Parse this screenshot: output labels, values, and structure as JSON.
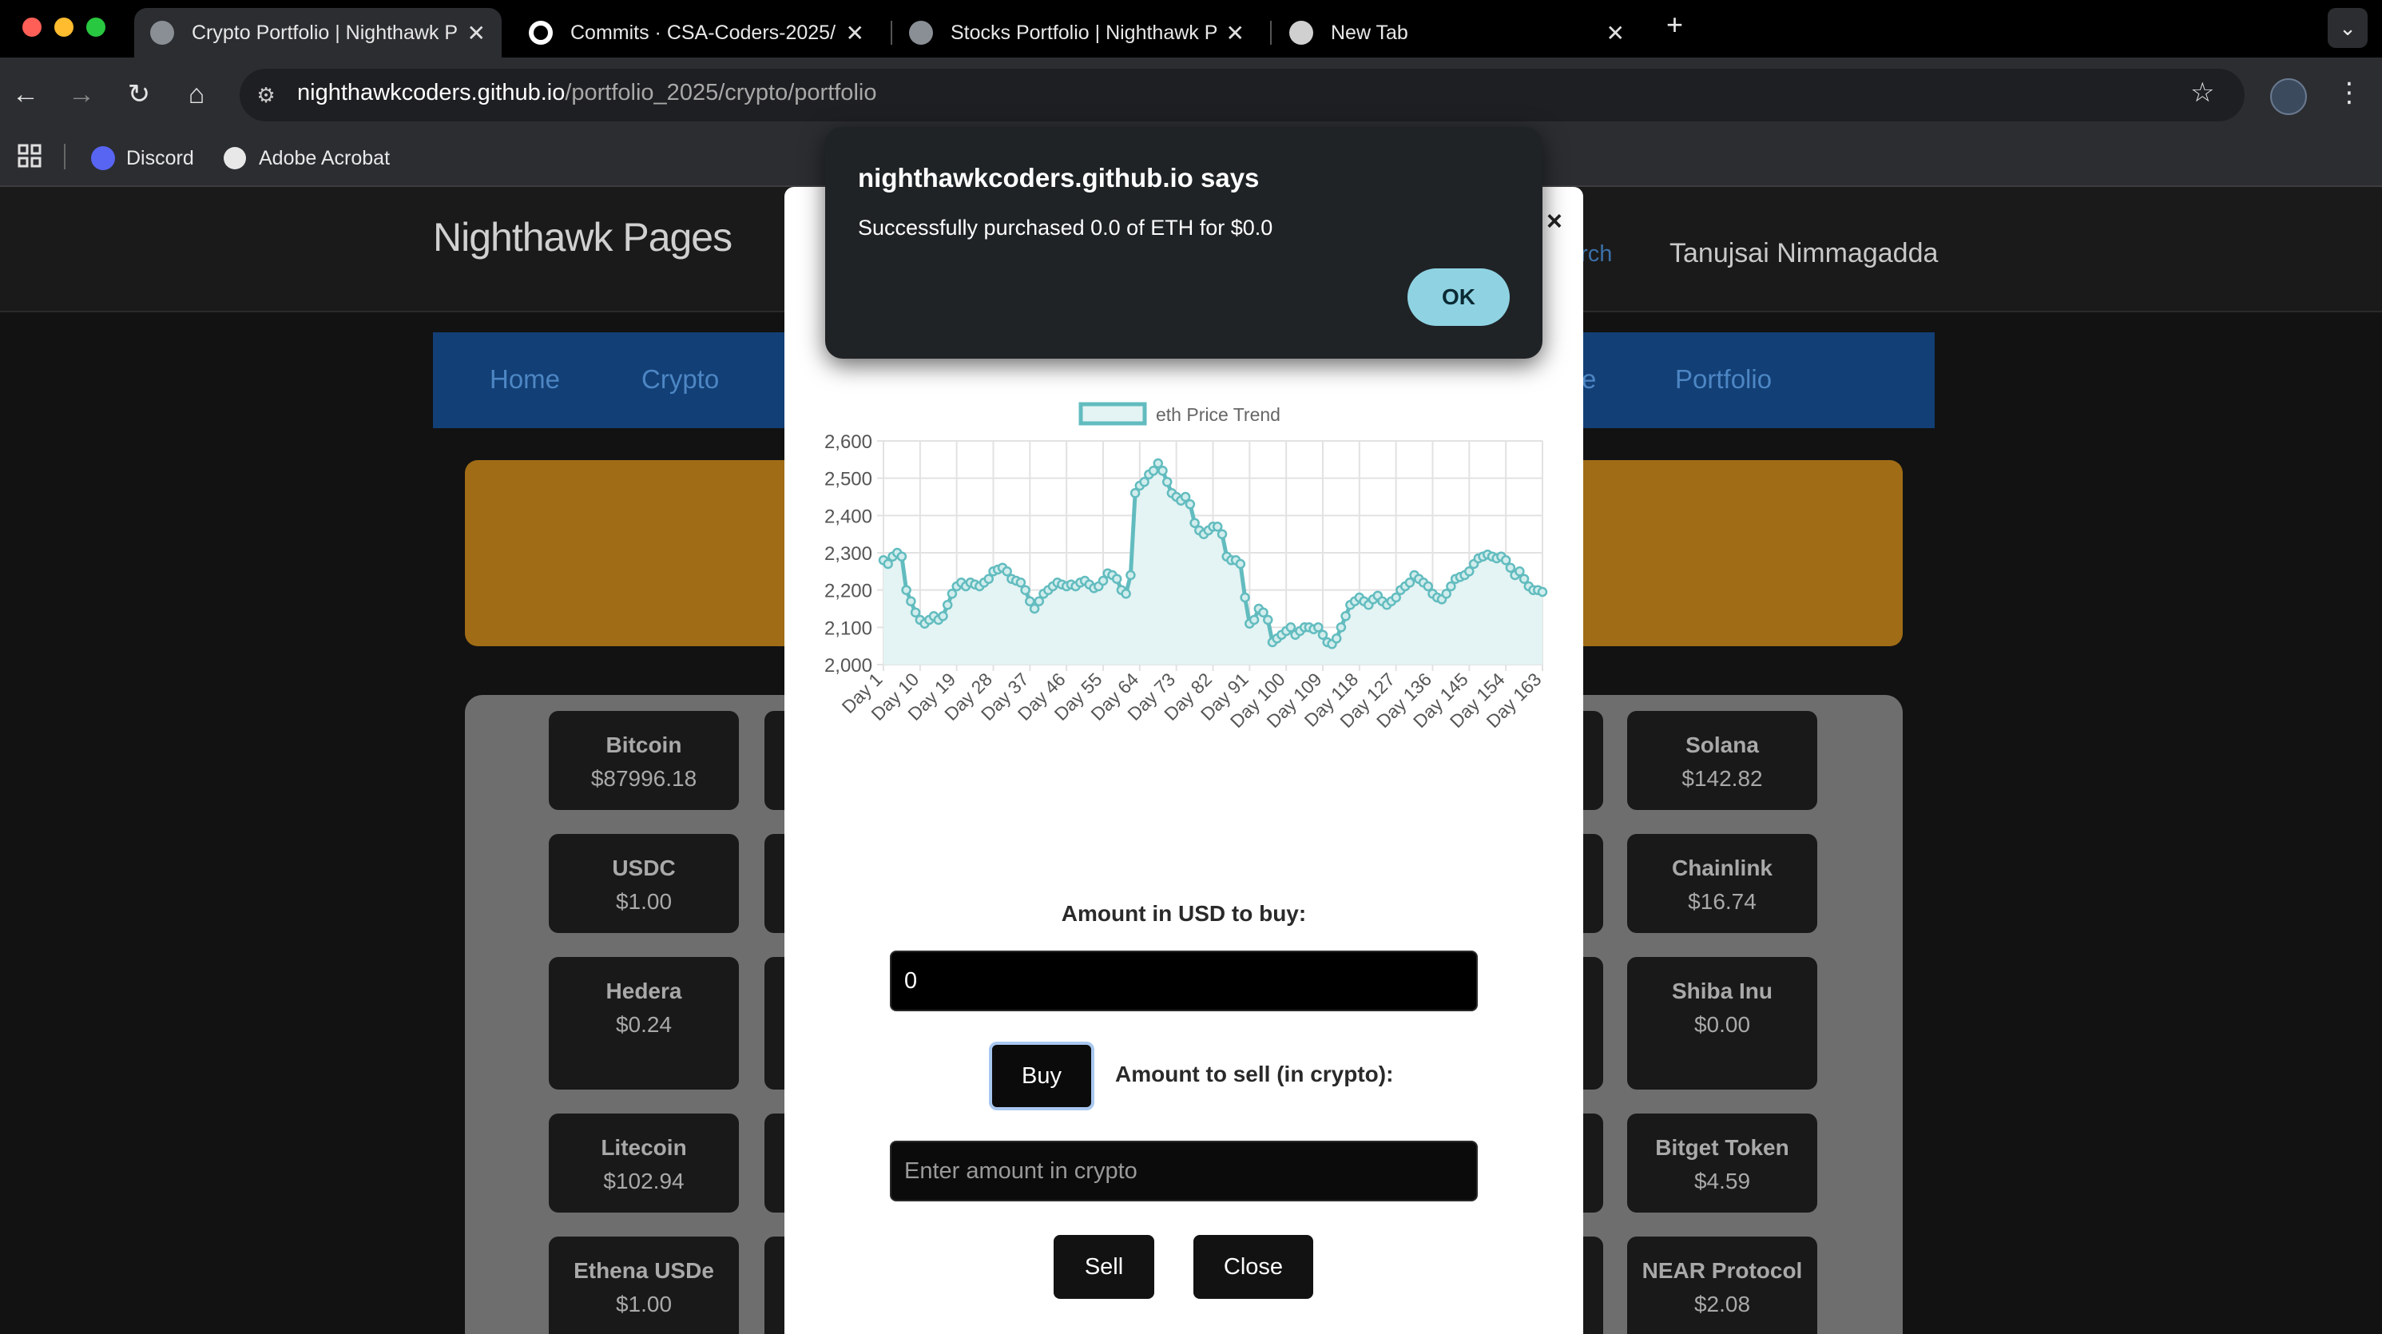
{
  "browser": {
    "tabs": [
      {
        "label": "Crypto Portfolio | Nighthawk P"
      },
      {
        "label": "Commits · CSA-Coders-2025/"
      },
      {
        "label": "Stocks Portfolio | Nighthawk P"
      },
      {
        "label": "New Tab"
      }
    ],
    "url_host": "nighthawkcoders.github.io",
    "url_path": "/portfolio_2025/crypto/portfolio",
    "bookmarks": [
      {
        "label": "Discord"
      },
      {
        "label": "Adobe Acrobat"
      }
    ]
  },
  "header": {
    "brand": "Nighthawk Pages",
    "search_link": "arch",
    "user": "Tanujsai Nimmagadda"
  },
  "nav": {
    "left": [
      {
        "label": "Home"
      },
      {
        "label": "Crypto"
      }
    ],
    "right": [
      {
        "label": "e"
      },
      {
        "label": "Portfolio"
      }
    ]
  },
  "crypto_cards": [
    {
      "name": "Bitcoin",
      "price": "$87996.18"
    },
    {
      "name": "Solana",
      "price": "$142.82"
    },
    {
      "name": "USDC",
      "price": "$1.00"
    },
    {
      "name": "Chainlink",
      "price": "$16.74"
    },
    {
      "name": "Hedera",
      "price": "$0.24"
    },
    {
      "name": "Shiba Inu",
      "price": "$0.00"
    },
    {
      "name": "Litecoin",
      "price": "$102.94"
    },
    {
      "name": "Bitget Token",
      "price": "$4.59"
    },
    {
      "name": "Ethena USDe",
      "price": "$1.00"
    },
    {
      "name": "NEAR Protocol",
      "price": "$2.08"
    }
  ],
  "modal": {
    "close_glyph": "×",
    "buy_label": "Amount in USD to buy:",
    "buy_value": "0",
    "buy_button": "Buy",
    "sell_label": "Amount to sell (in crypto):",
    "sell_placeholder": "Enter amount in crypto",
    "sell_button": "Sell",
    "close_button": "Close"
  },
  "alert": {
    "title": "nighthawkcoders.github.io says",
    "message": "Successfully purchased 0.0 of ETH for $0.0",
    "ok": "OK"
  },
  "colors": {
    "line": "#62bcbf",
    "fill": "#e4f3f3",
    "banner": "#a06c16",
    "navbar": "#123f75"
  },
  "chart_data": {
    "type": "line",
    "legend": "eth Price Trend",
    "ylim": [
      2000,
      2600
    ],
    "yticks": [
      "2,000",
      "2,100",
      "2,200",
      "2,300",
      "2,400",
      "2,500",
      "2,600"
    ],
    "xtick_labels": [
      "Day 1",
      "Day 10",
      "Day 19",
      "Day 28",
      "Day 37",
      "Day 46",
      "Day 55",
      "Day 64",
      "Day 73",
      "Day 82",
      "Day 91",
      "Day 100",
      "Day 109",
      "Day 118",
      "Day 127",
      "Day 136",
      "Day 145",
      "Day 154",
      "Day 163"
    ],
    "points": [
      [
        1,
        2280
      ],
      [
        2,
        2270
      ],
      [
        3,
        2290
      ],
      [
        4,
        2300
      ],
      [
        5,
        2290
      ],
      [
        6,
        2200
      ],
      [
        7,
        2170
      ],
      [
        8,
        2140
      ],
      [
        9,
        2120
      ],
      [
        10,
        2110
      ],
      [
        11,
        2120
      ],
      [
        12,
        2130
      ],
      [
        13,
        2120
      ],
      [
        14,
        2130
      ],
      [
        15,
        2160
      ],
      [
        16,
        2190
      ],
      [
        17,
        2210
      ],
      [
        18,
        2220
      ],
      [
        19,
        2210
      ],
      [
        20,
        2220
      ],
      [
        21,
        2215
      ],
      [
        22,
        2210
      ],
      [
        23,
        2220
      ],
      [
        24,
        2230
      ],
      [
        25,
        2250
      ],
      [
        26,
        2255
      ],
      [
        27,
        2260
      ],
      [
        28,
        2250
      ],
      [
        29,
        2230
      ],
      [
        30,
        2225
      ],
      [
        31,
        2220
      ],
      [
        32,
        2200
      ],
      [
        33,
        2170
      ],
      [
        34,
        2150
      ],
      [
        35,
        2170
      ],
      [
        36,
        2190
      ],
      [
        37,
        2200
      ],
      [
        38,
        2210
      ],
      [
        39,
        2220
      ],
      [
        40,
        2215
      ],
      [
        41,
        2210
      ],
      [
        42,
        2215
      ],
      [
        43,
        2210
      ],
      [
        44,
        2220
      ],
      [
        45,
        2225
      ],
      [
        46,
        2215
      ],
      [
        47,
        2205
      ],
      [
        48,
        2210
      ],
      [
        49,
        2225
      ],
      [
        50,
        2245
      ],
      [
        51,
        2240
      ],
      [
        52,
        2230
      ],
      [
        53,
        2200
      ],
      [
        54,
        2190
      ],
      [
        55,
        2240
      ],
      [
        56,
        2460
      ],
      [
        57,
        2480
      ],
      [
        58,
        2490
      ],
      [
        59,
        2510
      ],
      [
        60,
        2520
      ],
      [
        61,
        2540
      ],
      [
        62,
        2520
      ],
      [
        63,
        2490
      ],
      [
        64,
        2460
      ],
      [
        65,
        2450
      ],
      [
        66,
        2440
      ],
      [
        67,
        2450
      ],
      [
        68,
        2430
      ],
      [
        69,
        2380
      ],
      [
        70,
        2360
      ],
      [
        71,
        2350
      ],
      [
        72,
        2360
      ],
      [
        73,
        2370
      ],
      [
        74,
        2370
      ],
      [
        75,
        2350
      ],
      [
        76,
        2290
      ],
      [
        77,
        2280
      ],
      [
        78,
        2280
      ],
      [
        79,
        2270
      ],
      [
        80,
        2180
      ],
      [
        81,
        2110
      ],
      [
        82,
        2120
      ],
      [
        83,
        2150
      ],
      [
        84,
        2140
      ],
      [
        85,
        2120
      ],
      [
        86,
        2060
      ],
      [
        87,
        2070
      ],
      [
        88,
        2080
      ],
      [
        89,
        2090
      ],
      [
        90,
        2100
      ],
      [
        91,
        2080
      ],
      [
        92,
        2090
      ],
      [
        93,
        2100
      ],
      [
        94,
        2100
      ],
      [
        95,
        2095
      ],
      [
        96,
        2100
      ],
      [
        97,
        2080
      ],
      [
        98,
        2060
      ],
      [
        99,
        2055
      ],
      [
        100,
        2070
      ],
      [
        101,
        2100
      ],
      [
        102,
        2130
      ],
      [
        103,
        2160
      ],
      [
        104,
        2170
      ],
      [
        105,
        2180
      ],
      [
        106,
        2170
      ],
      [
        107,
        2160
      ],
      [
        108,
        2175
      ],
      [
        109,
        2185
      ],
      [
        110,
        2170
      ],
      [
        111,
        2160
      ],
      [
        112,
        2170
      ],
      [
        113,
        2180
      ],
      [
        114,
        2200
      ],
      [
        115,
        2210
      ],
      [
        116,
        2220
      ],
      [
        117,
        2240
      ],
      [
        118,
        2230
      ],
      [
        119,
        2220
      ],
      [
        120,
        2210
      ],
      [
        121,
        2190
      ],
      [
        122,
        2180
      ],
      [
        123,
        2175
      ],
      [
        124,
        2190
      ],
      [
        125,
        2210
      ],
      [
        126,
        2230
      ],
      [
        127,
        2235
      ],
      [
        128,
        2240
      ],
      [
        129,
        2250
      ],
      [
        130,
        2270
      ],
      [
        131,
        2285
      ],
      [
        132,
        2290
      ],
      [
        133,
        2295
      ],
      [
        134,
        2290
      ],
      [
        135,
        2285
      ],
      [
        136,
        2290
      ],
      [
        137,
        2280
      ],
      [
        138,
        2260
      ],
      [
        139,
        2240
      ],
      [
        140,
        2250
      ],
      [
        141,
        2230
      ],
      [
        142,
        2210
      ],
      [
        143,
        2200
      ],
      [
        144,
        2200
      ],
      [
        145,
        2195
      ]
    ]
  }
}
